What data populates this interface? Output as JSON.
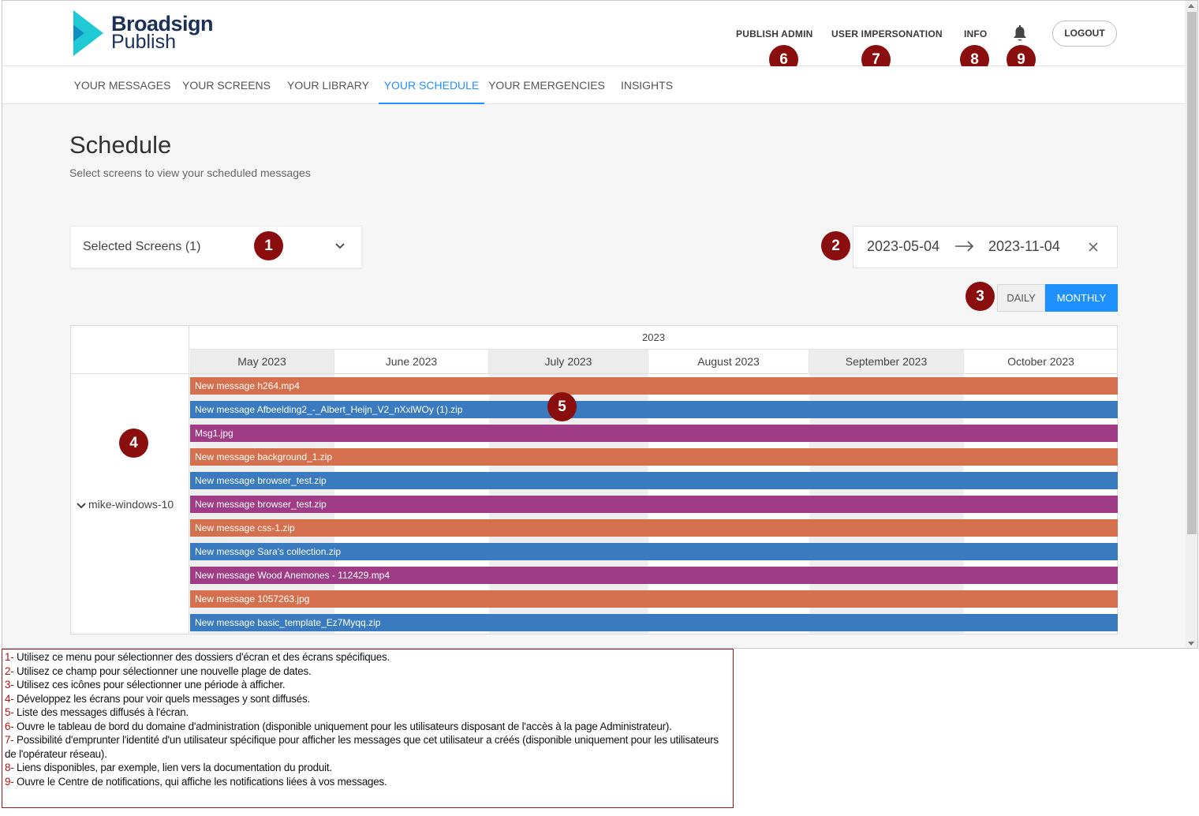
{
  "app": {
    "logo_line1": "Broadsign",
    "logo_line2": "Publish"
  },
  "header": {
    "links": [
      "PUBLISH ADMIN",
      "USER IMPERSONATION",
      "INFO"
    ],
    "logout_label": "LOGOUT"
  },
  "nav": {
    "tabs": [
      "YOUR MESSAGES",
      "YOUR SCREENS",
      "YOUR LIBRARY",
      "YOUR SCHEDULE",
      "YOUR EMERGENCIES",
      "INSIGHTS"
    ],
    "active": "YOUR SCHEDULE"
  },
  "page": {
    "title": "Schedule",
    "subtitle": "Select screens to view your scheduled messages"
  },
  "screen_select": {
    "value": "Selected Screens (1)"
  },
  "date_range": {
    "start": "2023-05-04",
    "end": "2023-11-04"
  },
  "view_toggle": {
    "daily": "DAILY",
    "monthly": "MONTHLY",
    "selected": "MONTHLY"
  },
  "timeline": {
    "year": "2023",
    "months": [
      "May 2023",
      "June 2023",
      "July 2023",
      "August 2023",
      "September 2023",
      "October 2023"
    ],
    "screen": "mike-windows-10",
    "messages": [
      {
        "name": "New message h264.mp4",
        "color": "#d4704d"
      },
      {
        "name": "New message Afbeelding2_-_Albert_Heijn_V2_nXxlWOy (1).zip",
        "color": "#3a7bbf"
      },
      {
        "name": "Msg1.jpg",
        "color": "#a03c85"
      },
      {
        "name": "New message background_1.zip",
        "color": "#d4704d"
      },
      {
        "name": "New message browser_test.zip",
        "color": "#3a7bbf"
      },
      {
        "name": "New message browser_test.zip",
        "color": "#a03c85"
      },
      {
        "name": "New message css-1.zip",
        "color": "#d4704d"
      },
      {
        "name": "New message Sara's collection.zip",
        "color": "#3a7bbf"
      },
      {
        "name": "New message Wood Anemones - 112429.mp4",
        "color": "#a03c85"
      },
      {
        "name": "New message 1057263.jpg",
        "color": "#d4704d"
      },
      {
        "name": "New message basic_template_Ez7Myqq.zip",
        "color": "#3a7bbf"
      }
    ]
  },
  "markers": [
    "1",
    "2",
    "3",
    "4",
    "5",
    "6",
    "7",
    "8",
    "9"
  ],
  "colors": {
    "accent": "#1e90ff",
    "marker": "#8b0e0e",
    "legend_border": "#a01818"
  },
  "legend": [
    {
      "num": "1-",
      "text": " Utilisez ce menu pour sélectionner des dossiers d'écran et des écrans spécifiques."
    },
    {
      "num": "2-",
      "text": " Utilisez ce champ pour sélectionner une nouvelle plage de dates."
    },
    {
      "num": "3-",
      "text": " Utilisez ces icônes pour sélectionner une période à afficher."
    },
    {
      "num": "4-",
      "text": " Développez les écrans pour voir quels messages y sont diffusés."
    },
    {
      "num": "5-",
      "text": " Liste des messages diffusés à l'écran."
    },
    {
      "num": "6-",
      "text": " Ouvre le tableau de bord du domaine d'administration (disponible uniquement pour les utilisateurs disposant de l'accès à la page Administrateur)."
    },
    {
      "num": "7-",
      "text": " Possibilité d'emprunter l'identité d'un utilisateur spécifique pour afficher les messages que cet utilisateur a créés (disponible uniquement pour les utilisateurs de l'opérateur réseau)."
    },
    {
      "num": "8-",
      "text": " Liens disponibles, par exemple, lien vers la documentation du produit."
    },
    {
      "num": "9-",
      "text": " Ouvre le Centre de notifications, qui affiche les notifications liées à vos messages."
    }
  ]
}
